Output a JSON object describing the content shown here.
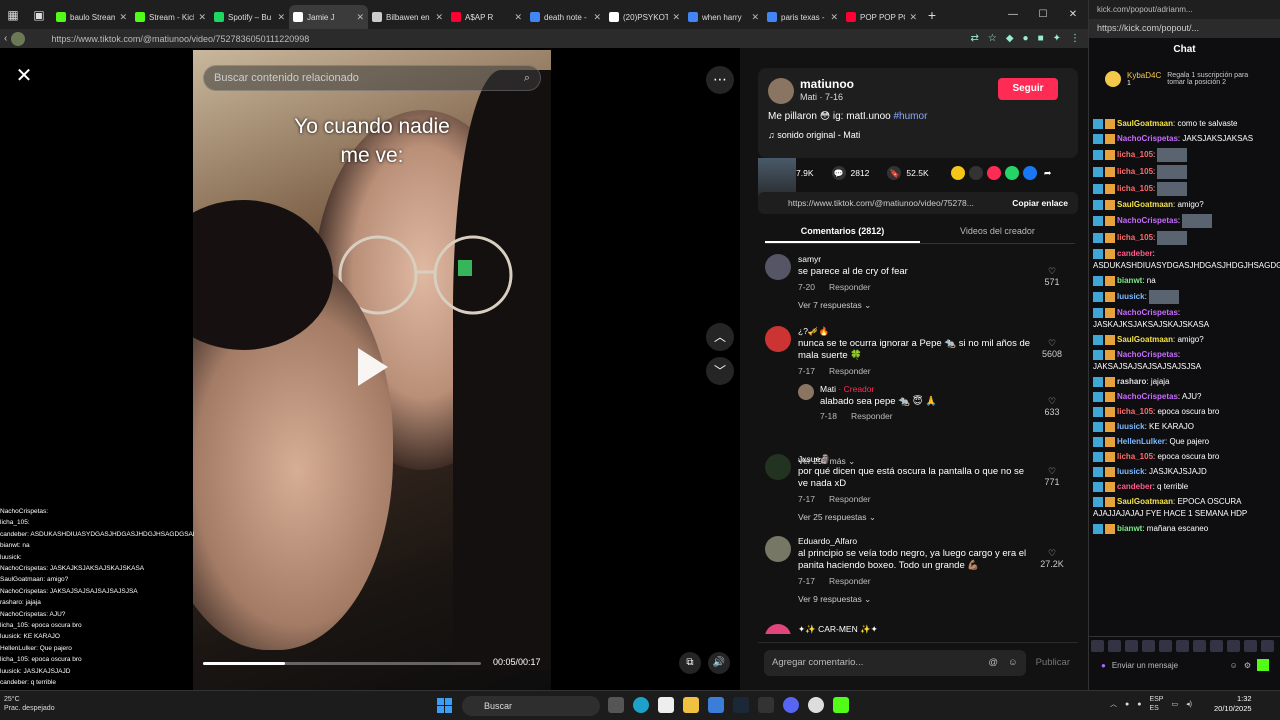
{
  "browser": {
    "tabs": [
      {
        "label": "baulo Stream",
        "color": "#53fc18"
      },
      {
        "label": "Stream - Kick",
        "color": "#53fc18"
      },
      {
        "label": "Spotify – Bu",
        "color": "#1ed760"
      },
      {
        "label": "Jamie J",
        "color": "#ffffff",
        "active": true
      },
      {
        "label": "Bilbawen en",
        "color": "#cccccc"
      },
      {
        "label": "A$AP R",
        "color": "#ff0033"
      },
      {
        "label": "death note -",
        "color": "#4285f4"
      },
      {
        "label": "(20)PSYKOTI",
        "color": "#ffffff"
      },
      {
        "label": "when harry",
        "color": "#4285f4"
      },
      {
        "label": "paris texas -",
        "color": "#4285f4"
      },
      {
        "label": "POP POP PO",
        "color": "#ff0033"
      }
    ],
    "url": "https://www.tiktok.com/@matiunoo/video/7527836050111220998",
    "new_tab": "+"
  },
  "video": {
    "search_placeholder": "Buscar contenido relacionado",
    "caption_line1": "Yo cuando nadie",
    "caption_line2": "me ve:",
    "time": "00:05/00:17",
    "progress_fraction": 0.294
  },
  "post": {
    "username": "matiunoo",
    "subtitle": "Mati · 7-16",
    "follow": "Seguir",
    "description": "Me pillaron 😳 ig: matI.unoo",
    "hashtag": "#humor",
    "sound": "♫  sonido original - Mati",
    "likes": "7.9K",
    "comments_count": "2812",
    "saves": "52.5K",
    "link": "https://www.tiktok.com/@matiunoo/video/75278...",
    "copy_link": "Copiar enlace",
    "tab_comments": "Comentarios (2812)",
    "tab_creator": "Videos del creador",
    "add_comment": "Agregar comentario...",
    "publish": "Publicar"
  },
  "comments": [
    {
      "name": "samyr",
      "text": "se parece al de cry of fear",
      "date": "7-20",
      "reply": "Responder",
      "likes": "571",
      "replies": "Ver 7 respuestas  ⌄",
      "color": "#556"
    },
    {
      "name": "¿?🎺🔥",
      "text": "nunca se te ocurra ignorar a Pepe 🐀 si no mil años de mala suerte 🍀",
      "date": "7-17",
      "reply": "Responder",
      "likes": "5608",
      "replies": "Ver 296 más  ⌄",
      "color": "#c33"
    },
    {
      "name": "Jxsue🗿",
      "text": "por qué dicen que está oscura la pantalla o que no se ve nada xD",
      "date": "7-17",
      "reply": "Responder",
      "likes": "771",
      "replies": "Ver 25 respuestas  ⌄",
      "color": "#232"
    },
    {
      "name": "Eduardo_Alfaro",
      "text": "al principio se veía todo negro, ya luego cargo y era el panita haciendo boxeo. Todo un grande 💪🏽",
      "date": "7-17",
      "reply": "Responder",
      "likes": "27.2K",
      "replies": "Ver 9 respuestas  ⌄",
      "color": "#776"
    }
  ],
  "creator_reply": {
    "name": "Mati",
    "badge": " · Creador",
    "text": "alabado sea pepe 🐀 😇 🙏",
    "date": "7-18",
    "reply": "Responder",
    "likes": "633"
  },
  "partial_comment": "✦✨ CAR-MEN ✨✦",
  "kick": {
    "tab_url": "kick.com/popout/adrianm...",
    "url": "https://kick.com/popout/...",
    "title": "Chat",
    "pin_user": "KybaD4C",
    "pin_count": "1",
    "pin_text": "Regala 1 suscripción para tomar la posición 2",
    "messages": [
      {
        "user": "SaulGoatmaan",
        "color": "#f3e14b",
        "text": "como te salvaste"
      },
      {
        "user": "NachoCrispetas",
        "color": "#c86bff",
        "text": "JAKSJAKSJAKSAS"
      },
      {
        "user": "licha_105",
        "color": "#ff6b6b",
        "text": ""
      },
      {
        "user": "licha_105",
        "color": "#ff6b6b",
        "text": ""
      },
      {
        "user": "licha_105",
        "color": "#ff6b6b",
        "text": ""
      },
      {
        "user": "SaulGoatmaan",
        "color": "#f3e14b",
        "text": "amigo?"
      },
      {
        "user": "NachoCrispetas",
        "color": "#c86bff",
        "text": ""
      },
      {
        "user": "licha_105",
        "color": "#ff6b6b",
        "text": ""
      },
      {
        "user": "candeber",
        "color": "#ff5a8a",
        "text": "ASDUKASHDIUASYDGASJHDGASJHDGJHSAGDGSADJ"
      },
      {
        "user": "bianwt",
        "color": "#7ee787",
        "text": "na"
      },
      {
        "user": "luusick",
        "color": "#7ab8ff",
        "text": ""
      },
      {
        "user": "NachoCrispetas",
        "color": "#c86bff",
        "text": "JASKAJKSJAKSAJSKAJSKASA"
      },
      {
        "user": "SaulGoatmaan",
        "color": "#f3e14b",
        "text": "amigo?"
      },
      {
        "user": "NachoCrispetas",
        "color": "#c86bff",
        "text": "JAKSAJSAJSAJSAJSAJSJSA"
      },
      {
        "user": "rasharo",
        "color": "#dddddd",
        "text": "jajaja"
      },
      {
        "user": "NachoCrispetas",
        "color": "#c86bff",
        "text": "AJU?"
      },
      {
        "user": "licha_105",
        "color": "#ff6b6b",
        "text": "epoca oscura bro"
      },
      {
        "user": "luusick",
        "color": "#7ab8ff",
        "text": "KE KARAJO"
      },
      {
        "user": "HellenLulker",
        "color": "#7ab8ff",
        "text": "Que pajero"
      },
      {
        "user": "licha_105",
        "color": "#ff6b6b",
        "text": "epoca oscura bro"
      },
      {
        "user": "luusick",
        "color": "#7ab8ff",
        "text": "JASJKAJSJAJD"
      },
      {
        "user": "candeber",
        "color": "#ff5a8a",
        "text": "q terrible"
      },
      {
        "user": "SaulGoatmaan",
        "color": "#f3e14b",
        "text": "EPOCA OSCURA AJAJJAJAJAJ FYE HACE 1 SEMANA HDP"
      },
      {
        "user": "bianwt",
        "color": "#7ee787",
        "text": "mañana escaneo"
      }
    ],
    "send_label": "Enviar un mensaje"
  },
  "overlay_chat": [
    "NachoCrispetas:",
    "licha_105:",
    "candeber: ASDUKASHDIUASYDGASJHDGASJHDGJHSAGDGSADJ",
    "bianwt: na",
    "luusick:",
    "NachoCrispetas: JASKAJKSJAKSAJSKAJSKASA",
    "SaulGoatmaan: amigo?",
    "NachoCrispetas: JAKSAJSAJSAJSAJSAJSJSA",
    "rasharo: jajaja",
    "NachoCrispetas: AJU?",
    "licha_105: epoca oscura bro",
    "luusick: KE KARAJO",
    "HellenLulker: Que pajero",
    "licha_105: epoca oscura bro",
    "luusick: JASJKAJSJAJD",
    "candeber: q terrible",
    "SaulGoatmaan: EPOCA OSCURA AJAJJAJAJAJ FYE HACE 1 SEMANA HDP",
    "bianwt: mañana escaneo"
  ],
  "taskbar": {
    "search": "Buscar",
    "weather_temp": "25°C",
    "weather_desc": "Prac. despejado",
    "lang1": "ESP",
    "lang2": "ES",
    "time": "1:32",
    "date": "20/10/2025"
  }
}
